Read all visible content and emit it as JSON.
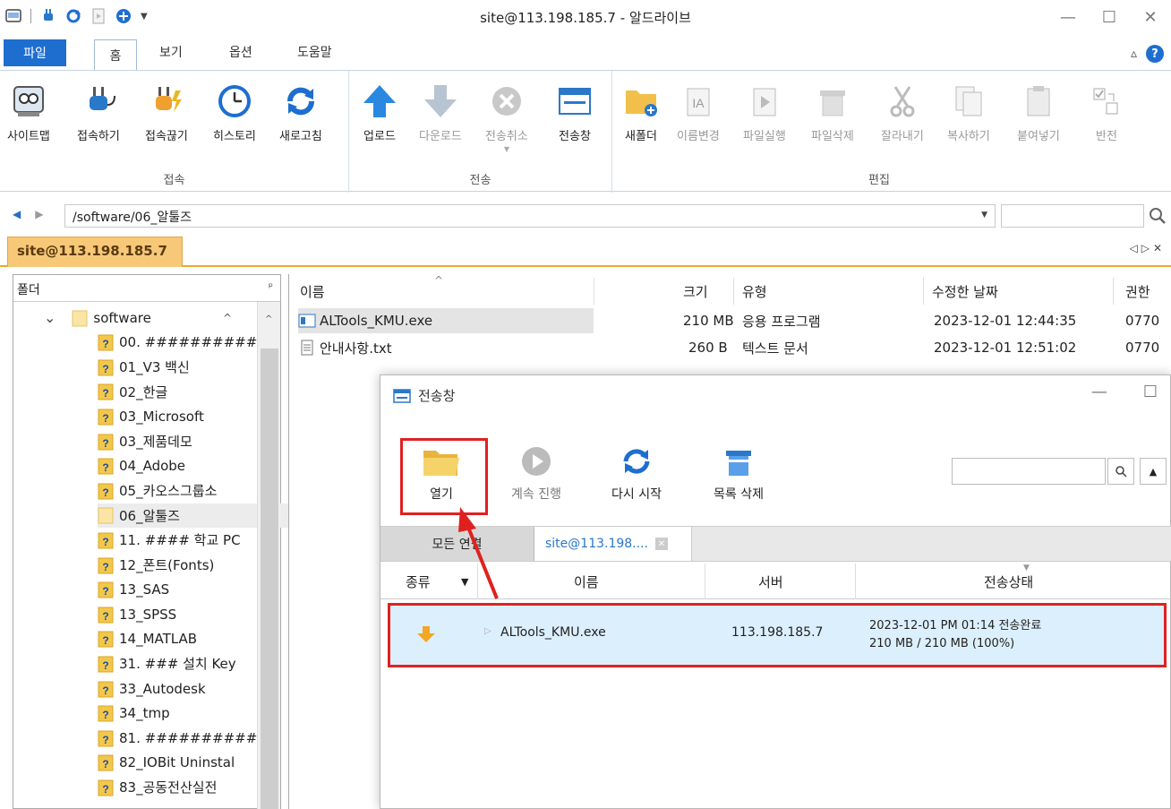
{
  "window": {
    "title": "site@113.198.185.7 - 알드라이브",
    "minimize": "—",
    "maximize": "☐",
    "close": "✕"
  },
  "ribbon_tabs": [
    "파일",
    "홈",
    "보기",
    "옵션",
    "도움말"
  ],
  "ribbon_right": {
    "collapse": "▵",
    "help": "?"
  },
  "groups": {
    "connect": {
      "label": "접속",
      "buttons": [
        "사이트맵",
        "접속하기",
        "접속끊기",
        "히스토리",
        "새로고침"
      ]
    },
    "transfer": {
      "label": "전송",
      "buttons": [
        "업로드",
        "다운로드",
        "전송취소",
        "전송창"
      ]
    },
    "edit": {
      "label": "편집",
      "buttons": [
        "새폴더",
        "이름변경",
        "파일실행",
        "파일삭제",
        "잘라내기",
        "복사하기",
        "붙여넣기",
        "반전"
      ]
    }
  },
  "address": {
    "path": "/software/06_알툴즈",
    "search_value": ""
  },
  "session_tab": "site@113.198.185.7",
  "session_nav": "◁▷✕",
  "folder_pane": {
    "title": "폴더",
    "pin": "ᵖ",
    "items": [
      "software",
      "00. ##########",
      "01_V3 백신",
      "02_한글",
      "03_Microsoft",
      "03_제품데모",
      "04_Adobe",
      "05_카오스그룹소",
      "06_알툴즈",
      "11. #### 학교 PC",
      "12_폰트(Fonts)",
      "13_SAS",
      "13_SPSS",
      "14_MATLAB",
      "31. ### 설치 Key",
      "33_Autodesk",
      "34_tmp",
      "81. ##########",
      "82_IOBit Uninstal",
      "83_공동전산실전"
    ]
  },
  "file_list": {
    "headers": {
      "name": "이름",
      "size": "크기",
      "type": "유형",
      "modified": "수정한 날짜",
      "perm": "권한"
    },
    "rows": [
      {
        "name": "ALTools_KMU.exe",
        "size": "210 MB",
        "type": "응용 프로그램",
        "modified": "2023-12-01 12:44:35",
        "perm": "0770"
      },
      {
        "name": "안내사항.txt",
        "size": "260 B",
        "type": "텍스트 문서",
        "modified": "2023-12-01 12:51:02",
        "perm": "0770"
      }
    ]
  },
  "transfer_window": {
    "title": "전송창",
    "buttons": {
      "open": "열기",
      "resume": "계속 진행",
      "restart": "다시 시작",
      "clear": "목록 삭제"
    },
    "search_value": "",
    "tabs": {
      "all": "모든 연결",
      "site": "site@113.198...."
    },
    "columns": {
      "kind": "종류",
      "name": "이름",
      "server": "서버",
      "status": "전송상태"
    },
    "rows": [
      {
        "name": "ALTools_KMU.exe",
        "server": "113.198.185.7",
        "status_line1": "2023-12-01 PM 01:14 전송완료",
        "status_line2": "210 MB / 210 MB (100%)"
      }
    ]
  },
  "colors": {
    "accent": "#1e6ed0",
    "session": "#f7c877",
    "highlight": "#e02020",
    "row_selected": "#dceffd"
  }
}
